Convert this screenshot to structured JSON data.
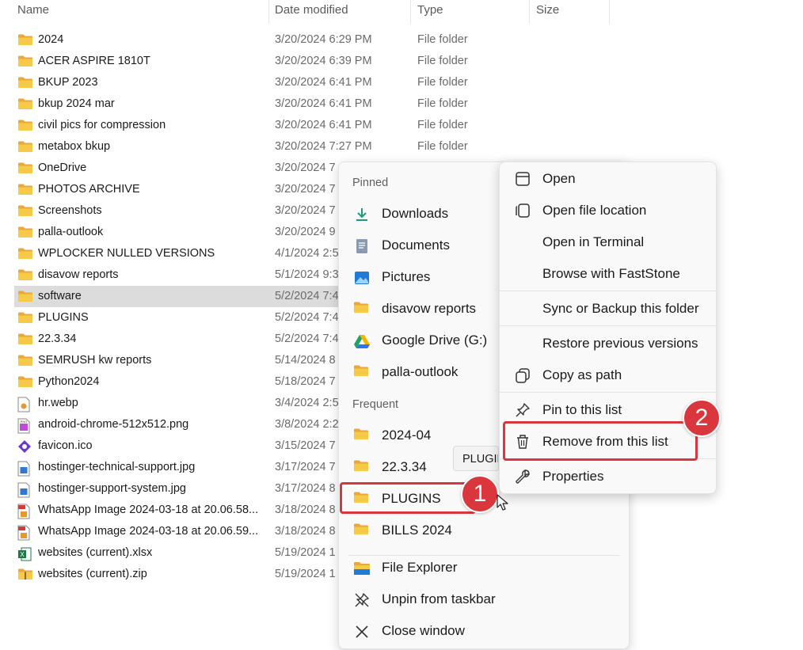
{
  "header": {
    "name": "Name",
    "date_modified": "Date modified",
    "type": "Type",
    "size": "Size"
  },
  "files": [
    {
      "name": "2024",
      "date": "3/20/2024 6:29 PM",
      "type": "File folder",
      "icon": "folder-icon"
    },
    {
      "name": "ACER ASPIRE 1810T",
      "date": "3/20/2024 6:39 PM",
      "type": "File folder",
      "icon": "folder-icon"
    },
    {
      "name": "BKUP 2023",
      "date": "3/20/2024 6:41 PM",
      "type": "File folder",
      "icon": "folder-icon"
    },
    {
      "name": "bkup 2024 mar",
      "date": "3/20/2024 6:41 PM",
      "type": "File folder",
      "icon": "folder-icon"
    },
    {
      "name": "civil pics for compression",
      "date": "3/20/2024 6:41 PM",
      "type": "File folder",
      "icon": "folder-icon"
    },
    {
      "name": "metabox bkup",
      "date": "3/20/2024 7:27 PM",
      "type": "File folder",
      "icon": "folder-icon"
    },
    {
      "name": "OneDrive",
      "date": "3/20/2024 7",
      "type": "",
      "icon": "folder-icon"
    },
    {
      "name": "PHOTOS ARCHIVE",
      "date": "3/20/2024 7",
      "type": "",
      "icon": "folder-icon"
    },
    {
      "name": "Screenshots",
      "date": "3/20/2024 7",
      "type": "",
      "icon": "folder-icon"
    },
    {
      "name": "palla-outlook",
      "date": "3/20/2024 9",
      "type": "",
      "icon": "folder-icon"
    },
    {
      "name": "WPLOCKER NULLED VERSIONS",
      "date": "4/1/2024 2:5",
      "type": "",
      "icon": "folder-icon"
    },
    {
      "name": "disavow reports",
      "date": "5/1/2024 9:3",
      "type": "",
      "icon": "folder-icon"
    },
    {
      "name": "software",
      "date": "5/2/2024 7:4",
      "type": "",
      "icon": "folder-icon",
      "selected": true
    },
    {
      "name": "PLUGINS",
      "date": "5/2/2024 7:4",
      "type": "",
      "icon": "folder-icon"
    },
    {
      "name": "22.3.34",
      "date": "5/2/2024 7:4",
      "type": "",
      "icon": "folder-icon"
    },
    {
      "name": "SEMRUSH kw reports",
      "date": "5/14/2024 8",
      "type": "",
      "icon": "folder-icon"
    },
    {
      "name": "Python2024",
      "date": "5/18/2024 7",
      "type": "",
      "icon": "folder-icon"
    },
    {
      "name": "hr.webp",
      "date": "3/4/2024 2:5",
      "type": "",
      "icon": "webp-file-icon"
    },
    {
      "name": "android-chrome-512x512.png",
      "date": "3/8/2024 2:2",
      "type": "",
      "icon": "png-file-icon"
    },
    {
      "name": "favicon.ico",
      "date": "3/15/2024 7",
      "type": "",
      "icon": "ico-file-icon"
    },
    {
      "name": "hostinger-technical-support.jpg",
      "date": "3/17/2024 7",
      "type": "",
      "icon": "jpg-file-icon"
    },
    {
      "name": "hostinger-support-system.jpg",
      "date": "3/17/2024 8",
      "type": "",
      "icon": "jpg-file-icon"
    },
    {
      "name": "WhatsApp Image 2024-03-18 at 20.06.58...",
      "date": "3/18/2024 8",
      "type": "",
      "icon": "pdf-image-icon"
    },
    {
      "name": "WhatsApp Image 2024-03-18 at 20.06.59...",
      "date": "3/18/2024 8",
      "type": "",
      "icon": "pdf-image-icon"
    },
    {
      "name": "websites (current).xlsx",
      "date": "5/19/2024 1",
      "type": "",
      "icon": "excel-file-icon"
    },
    {
      "name": "websites (current).zip",
      "date": "5/19/2024 1",
      "type": "",
      "icon": "zip-file-icon"
    }
  ],
  "jumplist": {
    "pinned_label": "Pinned",
    "pinned": [
      {
        "label": "Downloads",
        "icon": "download-icon"
      },
      {
        "label": "Documents",
        "icon": "documents-icon"
      },
      {
        "label": "Pictures",
        "icon": "pictures-icon"
      },
      {
        "label": "disavow reports",
        "icon": "folder-icon"
      },
      {
        "label": "Google Drive (G:)",
        "icon": "google-drive-icon"
      },
      {
        "label": "palla-outlook",
        "icon": "folder-icon"
      }
    ],
    "frequent_label": "Frequent",
    "frequent": [
      {
        "label": "2024-04",
        "icon": "folder-icon"
      },
      {
        "label": "22.3.34",
        "icon": "folder-icon"
      },
      {
        "label": "PLUGINS",
        "icon": "folder-icon"
      },
      {
        "label": "BILLS 2024",
        "icon": "folder-icon"
      }
    ],
    "tasks": [
      {
        "label": "File Explorer",
        "icon": "file-explorer-icon"
      },
      {
        "label": "Unpin from taskbar",
        "icon": "unpin-icon"
      },
      {
        "label": "Close window",
        "icon": "close-icon"
      }
    ]
  },
  "context_menu": {
    "items": [
      {
        "label": "Open",
        "icon": "window-icon"
      },
      {
        "label": "Open file location",
        "icon": "copy-window-icon"
      },
      {
        "label": "Open in Terminal",
        "icon": ""
      },
      {
        "label": "Browse with FastStone",
        "icon": ""
      },
      {
        "label": "Sync or Backup this folder",
        "icon": ""
      },
      {
        "label": "Restore previous versions",
        "icon": ""
      },
      {
        "label": "Copy as path",
        "icon": "copy-path-icon"
      },
      {
        "label": "Pin to this list",
        "icon": "pin-icon"
      },
      {
        "label": "Remove from this list",
        "icon": "trash-icon"
      },
      {
        "label": "Properties",
        "icon": "wrench-icon"
      }
    ]
  },
  "tooltip": "PLUGINS",
  "annotations": {
    "step1": "1",
    "step2": "2",
    "highlight_color": "#d9363e"
  },
  "colors": {
    "folder": "#f5c542",
    "selected_row": "#dcdcdc",
    "menu_bg": "#f9f9f9"
  }
}
